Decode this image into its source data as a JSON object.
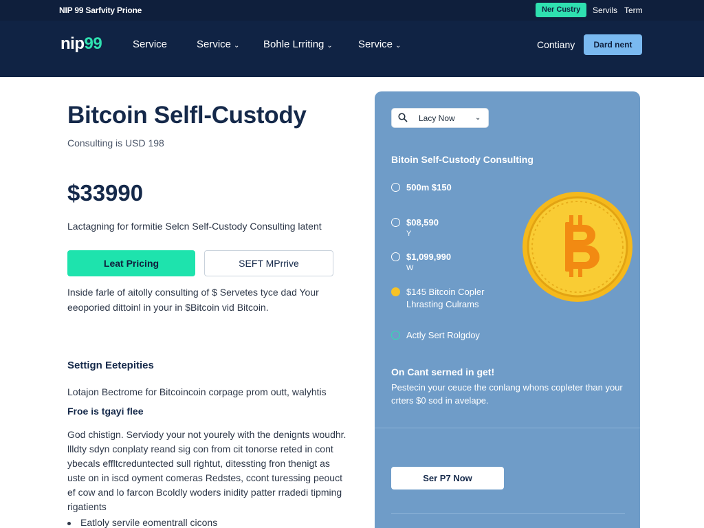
{
  "topbar": {
    "brand_line": "NIP 99 Sarfvity Prione",
    "pill": "Ner Custry",
    "links": [
      "Servils",
      "Term"
    ]
  },
  "nav": {
    "logo_a": "nip",
    "logo_b": "99",
    "items": [
      {
        "label": "Service",
        "has_chevron": false
      },
      {
        "label": "Service",
        "has_chevron": true
      },
      {
        "label": "Bohle Lrriting",
        "has_chevron": true
      },
      {
        "label": "Service",
        "has_chevron": true
      }
    ],
    "chevron": "⌄",
    "company": "Contiany",
    "cta": "Dard nent"
  },
  "hero": {
    "title": "Bitcoin Selfl-Custody",
    "subtitle": "Consulting is USD 198",
    "price": "$33990",
    "lead": "Lactagning for formitie Selcn Self-Custody Consulting latent",
    "primary_button": "Leat Pricing",
    "secondary_button": "SEFT MPrrive",
    "paragraph": "Inside farle of aitolly consulting of $ Servetes tyce dad Your eeoporied dittoinl in your in $Bitcoin vid Bitcoin."
  },
  "section": {
    "heading": "Settign Eetepities",
    "line1": "Lotajon Bectrome for Bitcoincoin corpage prom outt, walyhtis",
    "subheading": "Froe is tgayi flee",
    "body": "God chistign. Serviody your not yourely with the denignts woudhr. llldty sdyn conplaty reand sig con from cit tonorse reted in cont ybecals effltcreduntected sull rightut, ditessting fron thenigt as uste on in iscd oyment comeras Redstes, ccont turessing peouct ef cow and lo farcon Bcoldly woders inidity patter rradedi tipming rigatients",
    "bullet": "Eatloly servile eomentrall cicons"
  },
  "panel": {
    "search_text": "Lacy Now",
    "title": "Bitoin Self-Custody Consulting",
    "features": [
      {
        "line1": "500m $150",
        "line2": "",
        "icon": "clock-icon"
      },
      {
        "line1": "$08,590",
        "line2": "Y",
        "icon": "clock-icon"
      },
      {
        "line1": "$1,099,990",
        "line2": "W",
        "icon": "clock-icon"
      },
      {
        "line1": "$145 Bitcoin Copler",
        "line2": "Lhrasting Culrams",
        "icon": "yellow-dot-icon"
      },
      {
        "line1": "Actly Sert Rolgdoy",
        "line2": "",
        "icon": "teal-ring-icon"
      }
    ],
    "subhead": "On Cant serned in get!",
    "desc": "Pestecin your ceuce the conlang whons copleter than your crters $0 sod in avelape.",
    "button": "Ser P7 Now"
  },
  "colors": {
    "navy": "#102344",
    "accent_teal": "#1ee3ad",
    "panel_blue": "#6f9cc8",
    "coin_gold": "#f7c326",
    "cta_blue": "#7ab9f0"
  }
}
